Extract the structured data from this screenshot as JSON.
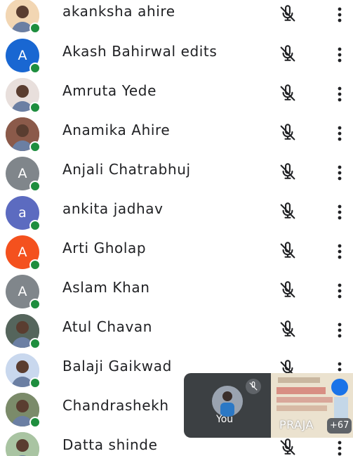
{
  "participants": [
    {
      "name": "akanksha ahire",
      "initial": "",
      "color": "#f2d6b3",
      "photo": true
    },
    {
      "name": "Akash Bahirwal edits",
      "initial": "A",
      "color": "#1967d2",
      "photo": false
    },
    {
      "name": "Amruta Yede",
      "initial": "",
      "color": "#e8dfdc",
      "photo": true
    },
    {
      "name": "Anamika Ahire",
      "initial": "",
      "color": "#8b5a4a",
      "photo": true
    },
    {
      "name": "Anjali Chatrabhuj",
      "initial": "A",
      "color": "#80868b",
      "photo": false
    },
    {
      "name": "ankita jadhav",
      "initial": "a",
      "color": "#5c6bc0",
      "photo": false
    },
    {
      "name": "Arti Gholap",
      "initial": "A",
      "color": "#f4511e",
      "photo": false
    },
    {
      "name": "Aslam Khan",
      "initial": "A",
      "color": "#80868b",
      "photo": false
    },
    {
      "name": "Atul Chavan",
      "initial": "",
      "color": "#55655c",
      "photo": true
    },
    {
      "name": "Balaji Gaikwad",
      "initial": "",
      "color": "#c9d8ee",
      "photo": true
    },
    {
      "name": "Chandrashekh",
      "initial": "",
      "color": "#7b8b6a",
      "photo": true
    },
    {
      "name": "Datta shinde",
      "initial": "",
      "color": "#a9c4a2",
      "photo": true
    }
  ],
  "icons": {
    "mic": "mic-off-icon",
    "more": "more-vert-icon",
    "status": "online-dot",
    "status_color": "#1e8e3e"
  },
  "self_tile": {
    "label": "You",
    "screen_share_text": "PRAJA",
    "others_count": "+67"
  }
}
